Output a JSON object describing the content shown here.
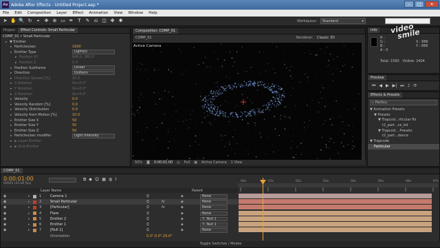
{
  "window": {
    "title": "Adobe After Effects - Untitled Project.aep *",
    "logo": "Ae"
  },
  "menu": [
    "File",
    "Edit",
    "Composition",
    "Layer",
    "Effect",
    "Animation",
    "View",
    "Window",
    "Help"
  ],
  "toolbar": {
    "workspace_label": "Workspace:",
    "workspace_value": "Standard"
  },
  "left_panel": {
    "tabs": [
      "Project",
      "Effect Controls: Small Particular"
    ],
    "header": "COMP_01 • Small Particular",
    "rows": [
      {
        "label": "▼ Emitter",
        "value": "",
        "indent": 1,
        "disabled": false
      },
      {
        "label": "Particles/sec",
        "value": "1600",
        "indent": 2,
        "disabled": false
      },
      {
        "label": "Emitter Type",
        "value": "Light(s)",
        "indent": 2,
        "disabled": false,
        "dropdown": true
      },
      {
        "label": "Position XY",
        "value": "640.0, 360.0",
        "indent": 3,
        "disabled": true
      },
      {
        "label": "Position Z",
        "value": "0.0",
        "indent": 3,
        "disabled": true
      },
      {
        "label": "Position Subframe",
        "value": "Linear",
        "indent": 2,
        "disabled": false,
        "dropdown": true
      },
      {
        "label": "Direction",
        "value": "Uniform",
        "indent": 2,
        "disabled": false,
        "dropdown": true
      },
      {
        "label": "Direction Spread [%]",
        "value": "20.0",
        "indent": 2,
        "disabled": true
      },
      {
        "label": "X Rotation",
        "value": "0x+0.0°",
        "indent": 2,
        "disabled": true
      },
      {
        "label": "Y Rotation",
        "value": "0x+0.0°",
        "indent": 2,
        "disabled": true
      },
      {
        "label": "Z Rotation",
        "value": "0x+0.0°",
        "indent": 2,
        "disabled": true
      },
      {
        "label": "Velocity",
        "value": "0.0",
        "indent": 2,
        "disabled": false
      },
      {
        "label": "Velocity Random [%]",
        "value": "0.0",
        "indent": 2,
        "disabled": false
      },
      {
        "label": "Velocity Distribution",
        "value": "0.0",
        "indent": 2,
        "disabled": false
      },
      {
        "label": "Velocity from Motion [%]",
        "value": "10.0",
        "indent": 2,
        "disabled": false
      },
      {
        "label": "Emitter Size X",
        "value": "50",
        "indent": 2,
        "disabled": false
      },
      {
        "label": "Emitter Size Y",
        "value": "50",
        "indent": 2,
        "disabled": false
      },
      {
        "label": "Emitter Size Z",
        "value": "50",
        "indent": 2,
        "disabled": false
      },
      {
        "label": "Particles/sec modifier",
        "value": "Light Intensity",
        "indent": 2,
        "disabled": false,
        "dropdown": true
      },
      {
        "label": "▶ Layer Emitter",
        "value": "",
        "indent": 2,
        "disabled": true
      },
      {
        "label": "▶ Grid Emitter",
        "value": "",
        "indent": 2,
        "disabled": true
      }
    ]
  },
  "composition": {
    "tab": "Composition: COMP_01",
    "sub_tab": "COMP_01",
    "renderer_label": "Renderer:",
    "renderer_value": "Classic 3D",
    "camera_label": "Active Camera",
    "zoom": "50%",
    "timecode": "0:00:01:00",
    "resolution": "Full",
    "view": "Active Camera",
    "views_count": "1 View"
  },
  "info_panel": {
    "tab": "Info",
    "r": "R :",
    "g": "G :",
    "b": "B :",
    "a": "A : 0",
    "x": "X : 886",
    "y": "Y : 886",
    "total": "Total: 1560",
    "visible": "Visible: 2404"
  },
  "watermark": {
    "line1": "video",
    "line2": "smile"
  },
  "preview_panel": {
    "tab": "Preview"
  },
  "effects_panel": {
    "tab": "Effects & Presets",
    "search_value": "Particu",
    "tree": [
      {
        "label": "▼ Animation Presets",
        "indent": 0
      },
      {
        "label": "▼ Presets",
        "indent": 1
      },
      {
        "label": "▼ Trapcod...rticular ffx",
        "indent": 2
      },
      {
        "label": "t2_part...ce_bd",
        "indent": 3
      },
      {
        "label": "▼ Trapcod... Presets",
        "indent": 2
      },
      {
        "label": "t2_part...dance",
        "indent": 3
      },
      {
        "label": "▼ Trapcode",
        "indent": 0
      },
      {
        "label": "Particular",
        "indent": 1,
        "selected": true
      }
    ]
  },
  "timeline": {
    "tab": "COMP_01",
    "timecode": "0:00:01:00",
    "frame_info": "00025 (25.00 fps)",
    "search_placeholder": "",
    "col_layer_name": "Layer Name",
    "col_parent": "Parent",
    "ruler": [
      "00s",
      "01s",
      "02s",
      "03s",
      "04s",
      "05s",
      "06s",
      "07s"
    ],
    "layers": [
      {
        "num": "1",
        "name": "Camera 1",
        "color": "#b0b0b0",
        "parent": "None",
        "bar": "#b79a9a"
      },
      {
        "num": "2",
        "name": "Small Particular",
        "color": "#c23b30",
        "parent": "None",
        "bar": "#c47a6d",
        "selected": true,
        "fx": true
      },
      {
        "num": "3",
        "name": "[Particular]",
        "color": "#c23b30",
        "parent": "None",
        "bar": "#c47a6d",
        "fx": true
      },
      {
        "num": "4",
        "name": "Flare",
        "color": "#c78a52",
        "parent": "None",
        "bar": "#c8a37e"
      },
      {
        "num": "5",
        "name": "Emitter 2",
        "color": "#c78a52",
        "parent": "7. Null 1",
        "bar": "#c8a37e"
      },
      {
        "num": "6",
        "name": "Emitter 1",
        "color": "#c78a52",
        "parent": "7. Null 1",
        "bar": "#c8a37e"
      },
      {
        "num": "7",
        "name": "[Null 1]",
        "color": "#c78a52",
        "parent": "None",
        "bar": "#c8a37e"
      }
    ],
    "orientation_label": "Orientation",
    "orientation_value": "0.0°,0.0°,16.0°",
    "footer": "Toggle Switches / Modes"
  },
  "colors": {
    "accent": "#e5a23a",
    "playhead": "#e5a23a",
    "titlebar": "#4a78ac"
  }
}
